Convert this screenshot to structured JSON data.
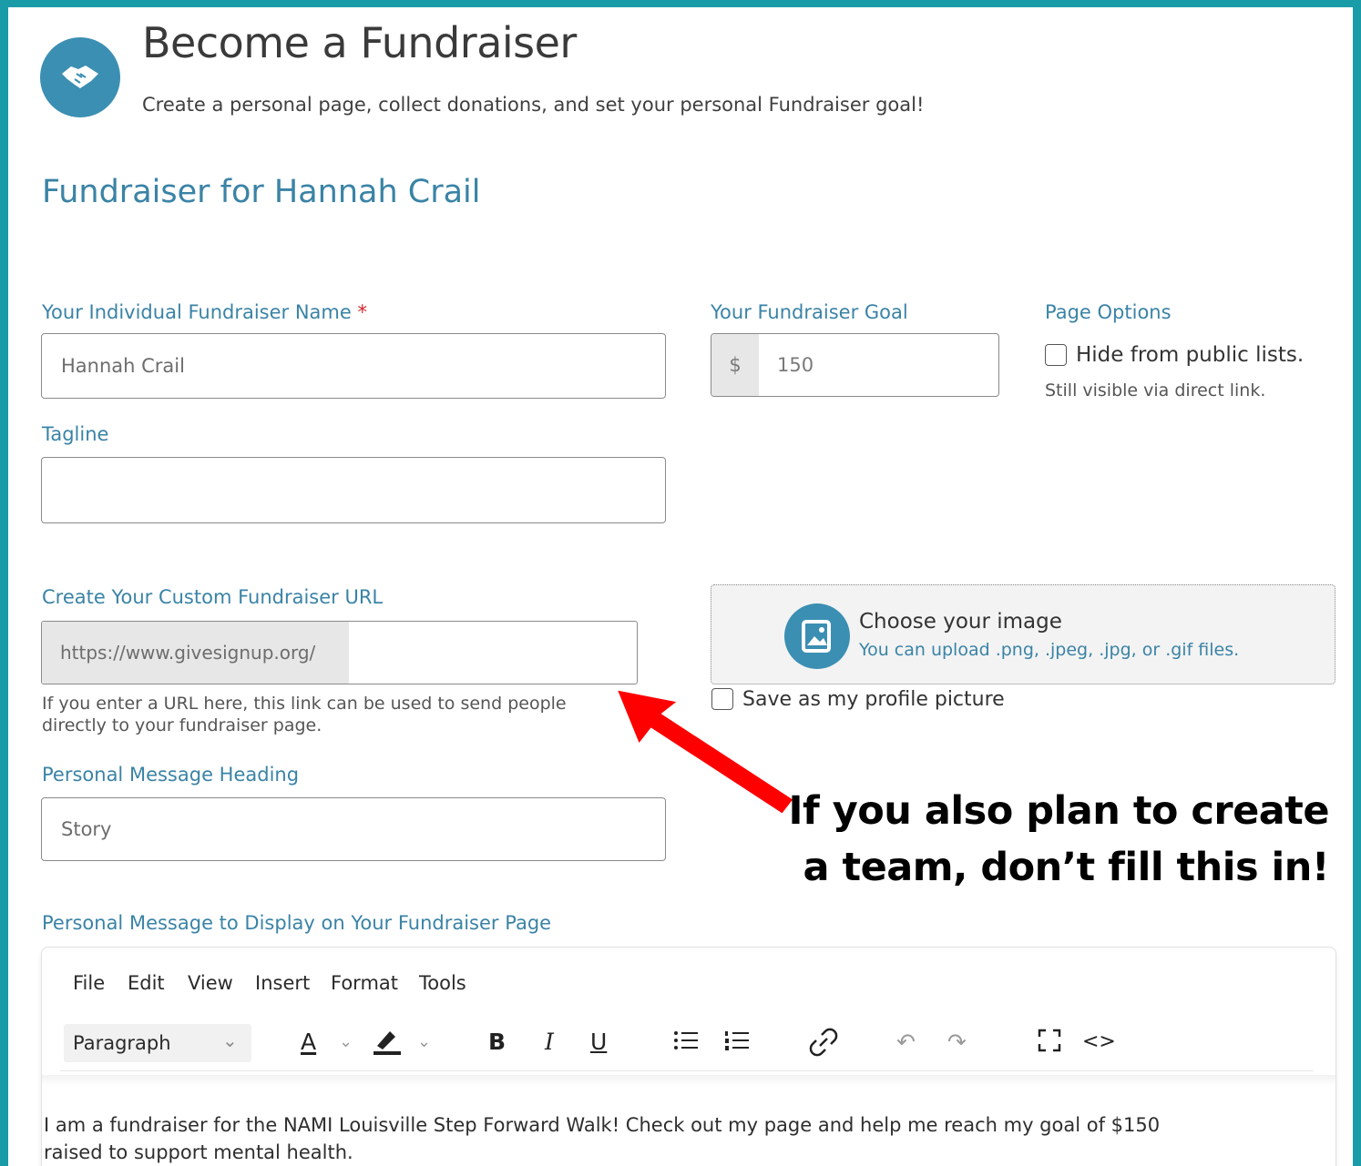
{
  "header": {
    "title": "Become a Fundraiser",
    "subtitle": "Create a personal page, collect donations, and set your personal Fundraiser goal!",
    "icon": "handshake-icon"
  },
  "section_title": "Fundraiser for Hannah Crail",
  "fields": {
    "name": {
      "label": "Your Individual Fundraiser Name",
      "required_mark": "*",
      "value": "Hannah Crail"
    },
    "goal": {
      "label": "Your Fundraiser Goal",
      "currency": "$",
      "value": "150"
    },
    "page_options": {
      "label": "Page Options",
      "hide_label": "Hide from public lists.",
      "hide_hint": "Still visible via direct link.",
      "hide_checked": false
    },
    "tagline": {
      "label": "Tagline",
      "value": ""
    },
    "url": {
      "label": "Create Your Custom Fundraiser URL",
      "prefix": "https://www.givesignup.org/",
      "value": "",
      "hint_line1": "If you enter a URL here, this link can be used to send people",
      "hint_line2": "directly to your fundraiser page."
    },
    "image": {
      "title": "Choose your image",
      "subtitle": "You can upload .png, .jpeg, .jpg, or .gif files.",
      "profile_label": "Save as my profile picture",
      "profile_checked": false
    },
    "message_heading": {
      "label": "Personal Message Heading",
      "value": "Story"
    },
    "message": {
      "label": "Personal Message to Display on Your Fundraiser Page"
    }
  },
  "callout": {
    "line1": "If you also plan to create",
    "line2": "a team, don’t fill this in!",
    "arrow_color": "#ff0000"
  },
  "editor": {
    "menu": [
      "File",
      "Edit",
      "View",
      "Insert",
      "Format",
      "Tools"
    ],
    "block_format": "Paragraph",
    "toolbar": {
      "text_color": "A",
      "bold": "B",
      "italic": "I",
      "underline": "U"
    },
    "content_line1": "I am a fundraiser for the NAMI Louisville Step Forward Walk! Check out my page and help me reach my goal of $150",
    "content_line2": "raised to support mental health."
  },
  "colors": {
    "border": "#1a9ba8",
    "accent": "#3a83a6",
    "icon_bg": "#3b8fb2",
    "required": "#d0262a"
  }
}
